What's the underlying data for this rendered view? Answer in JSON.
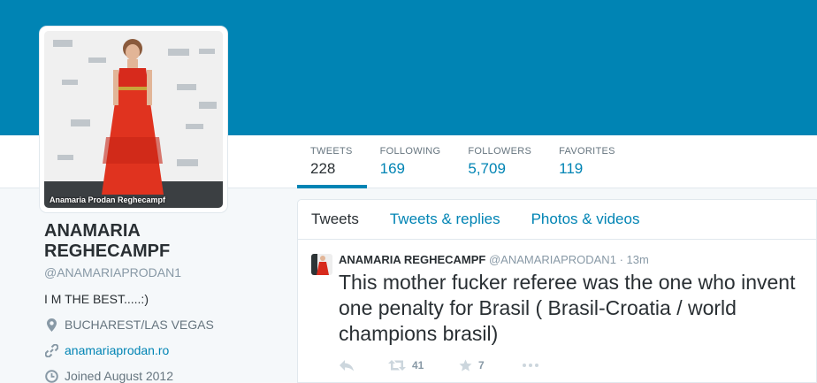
{
  "colors": {
    "brand": "#0084b4",
    "background": "#f5f8fa"
  },
  "avatar": {
    "caption": "Anamaria Prodan Reghecampf"
  },
  "stats": [
    {
      "label": "TWEETS",
      "value": "228"
    },
    {
      "label": "FOLLOWING",
      "value": "169"
    },
    {
      "label": "FOLLOWERS",
      "value": "5,709"
    },
    {
      "label": "FAVORITES",
      "value": "119"
    }
  ],
  "profile": {
    "name_line1": "ANAMARIA",
    "name_line2": "REGHECAMPF",
    "handle": "@ANAMARIAPRODAN1",
    "bio": "I M THE BEST.....:)",
    "location": "BUCHAREST/LAS VEGAS",
    "website": "anamariaprodan.ro",
    "joined": "Joined August 2012",
    "icons": [
      "location-pin-icon",
      "link-icon",
      "calendar-clock-icon"
    ]
  },
  "timeline": {
    "tabs": [
      "Tweets",
      "Tweets & replies",
      "Photos & videos"
    ],
    "tweet": {
      "name": "ANAMARIA REGHECAMPF",
      "handle": "@ANAMARIAPRODAN1",
      "separator": "·",
      "time": "13m",
      "text": "This mother fucker referee was the one who invent one penalty  for Brasil ( Brasil-Croatia / world champions brasil)",
      "retweets": "41",
      "favorites": "7"
    }
  }
}
